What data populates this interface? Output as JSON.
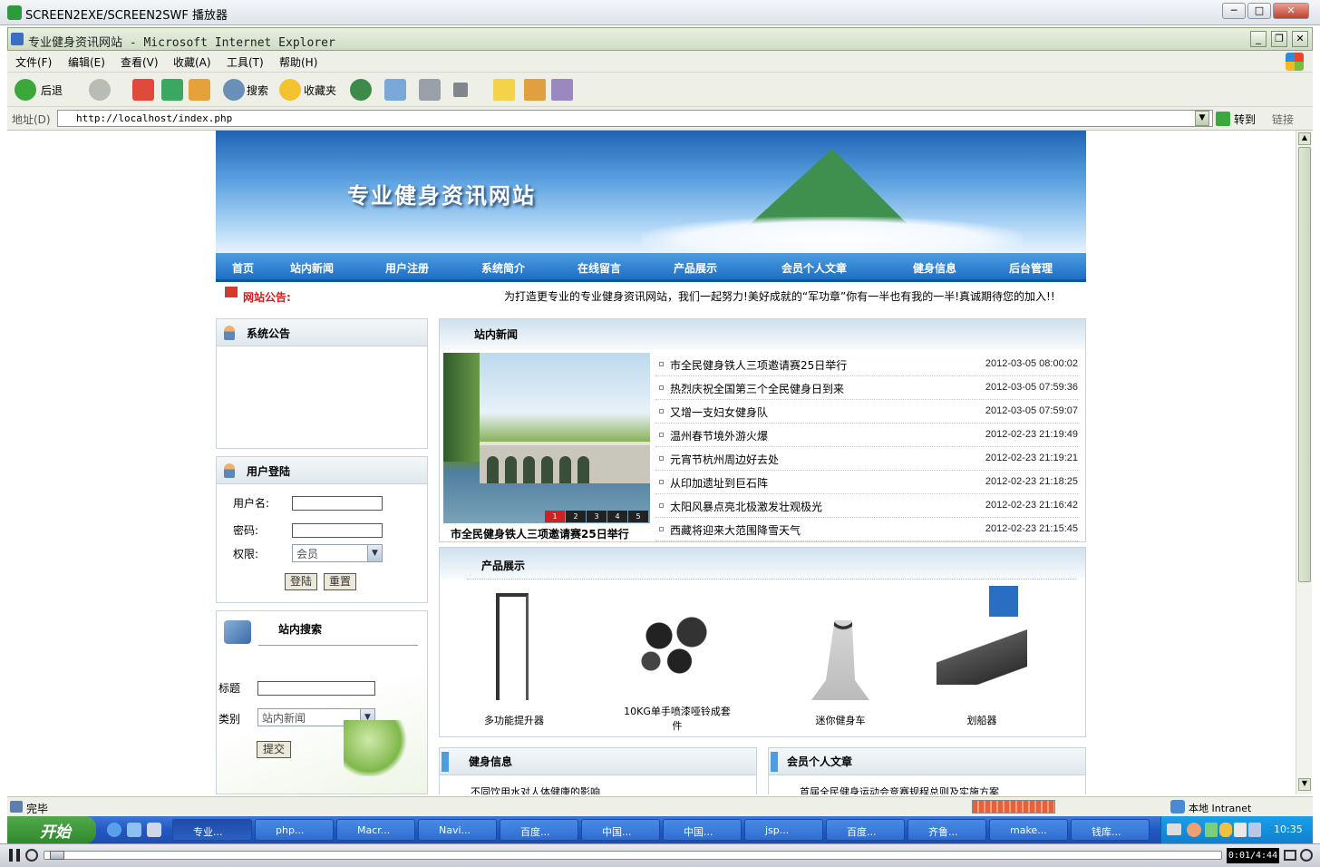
{
  "player": {
    "title": "SCREEN2EXE/SCREEN2SWF 播放器",
    "time": "0:01/4:44"
  },
  "ie": {
    "title": "专业健身资讯网站 - Microsoft Internet Explorer",
    "menu": [
      "文件(F)",
      "编辑(E)",
      "查看(V)",
      "收藏(A)",
      "工具(T)",
      "帮助(H)"
    ],
    "toolbar": {
      "back": "后退",
      "search": "搜索",
      "favorites": "收藏夹"
    },
    "address_label": "地址(D)",
    "address": "http://localhost/index.php",
    "go": "转到",
    "links": "链接",
    "status": "完毕",
    "zone": "本地 Intranet"
  },
  "site": {
    "title": "专业健身资讯网站",
    "nav": [
      "首页",
      "站内新闻",
      "用户注册",
      "系统简介",
      "在线留言",
      "产品展示",
      "会员个人文章",
      "健身信息",
      "后台管理"
    ],
    "notice_label": "网站公告:",
    "notice_text": "为打造更专业的专业健身资讯网站，我们一起努力!美好成就的“军功章”你有一半也有我的一半!真诚期待您的加入!!",
    "announce_title": "系统公告",
    "login": {
      "title": "用户登陆",
      "username_label": "用户名:",
      "password_label": "密码:",
      "role_label": "权限:",
      "role_value": "会员",
      "login_btn": "登陆",
      "reset_btn": "重置"
    },
    "search": {
      "title": "站内搜索",
      "title_label": "标题",
      "type_label": "类别",
      "type_value": "站内新闻",
      "submit": "提交"
    },
    "news": {
      "title": "站内新闻",
      "caption": "市全民健身铁人三项邀请赛25日举行",
      "pages": [
        "1",
        "2",
        "3",
        "4",
        "5"
      ],
      "items": [
        {
          "title": "市全民健身铁人三项邀请赛25日举行",
          "date": "2012-03-05 08:00:02"
        },
        {
          "title": "热烈庆祝全国第三个全民健身日到来",
          "date": "2012-03-05 07:59:36"
        },
        {
          "title": "又增一支妇女健身队",
          "date": "2012-03-05 07:59:07"
        },
        {
          "title": "温州春节境外游火爆",
          "date": "2012-02-23 21:19:49"
        },
        {
          "title": "元宵节杭州周边好去处",
          "date": "2012-02-23 21:19:21"
        },
        {
          "title": "从印加遗址到巨石阵",
          "date": "2012-02-23 21:18:25"
        },
        {
          "title": "太阳风暴点亮北极激发壮观极光",
          "date": "2012-02-23 21:16:42"
        },
        {
          "title": "西藏将迎来大范围降雪天气",
          "date": "2012-02-23 21:15:45"
        }
      ]
    },
    "products": {
      "title": "产品展示",
      "items": [
        {
          "name": "多功能提升器"
        },
        {
          "name": "10KG单手喷漆哑铃成套件"
        },
        {
          "name": "迷你健身车"
        },
        {
          "name": "划船器"
        }
      ]
    },
    "fitness": {
      "title": "健身信息",
      "first": "不同饮用水对人体健康的影响"
    },
    "articles": {
      "title": "会员个人文章",
      "first": "首届全民健身运动会竞赛规程总则及实施方案"
    }
  },
  "taskbar": {
    "start": "开始",
    "tasks": [
      "专业...",
      "php...",
      "Macr...",
      "Navi...",
      "百度...",
      "中国...",
      "中国...",
      "jsp...",
      "百度...",
      "齐鲁...",
      "make...",
      "钱库..."
    ],
    "clock": "10:35"
  }
}
